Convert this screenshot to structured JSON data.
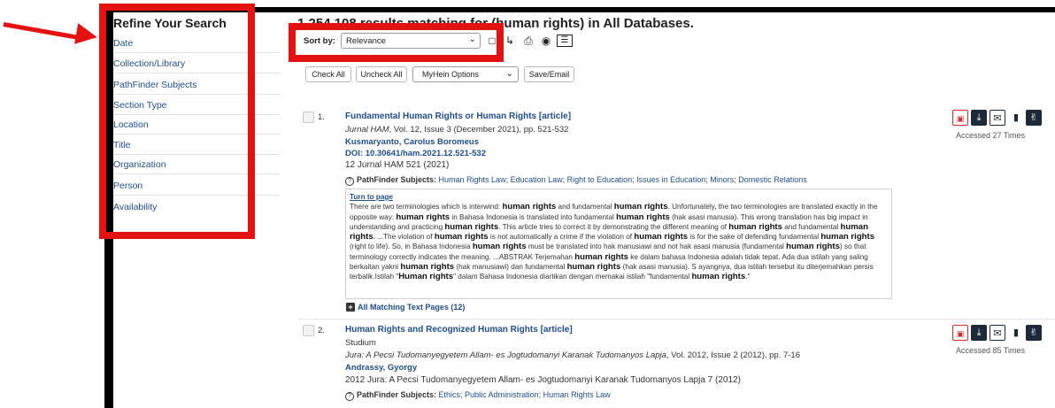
{
  "sidebar": {
    "title": "Refine Your Search",
    "facets": [
      "Date",
      "Collection/Library",
      "PathFinder Subjects",
      "Section Type",
      "Location",
      "Title",
      "Organization",
      "Person",
      "Availability"
    ]
  },
  "header": {
    "title": "1,254,108 results matching for (human rights) in All Databases."
  },
  "toolbar": {
    "sort_label": "Sort by:",
    "sort_value": "Relevance",
    "icons": [
      "refresh-icon",
      "sort-direction-icon",
      "print-icon",
      "binoculars-icon",
      "table-view-icon"
    ]
  },
  "actions": {
    "check_all": "Check All",
    "uncheck_all": "Uncheck All",
    "myhein": "MyHein Options",
    "save_email": "Save/Email"
  },
  "results": [
    {
      "num": "1.",
      "title": "Fundamental Human Rights or Human Rights [article]",
      "journal": "Jurnal HAM",
      "journal_detail": ", Vol. 12, Issue 3 (December 2021), pp. 521-532",
      "author": "Kusmaryanto, Carolus Boromeus",
      "doi": "DOI: 10.30641/ham.2021.12.521-532",
      "cite": "12 Jurnal HAM 521 (2021)",
      "pathfinder_label": "PathFinder Subjects:",
      "pathfinder": "Human Rights Law; Education Law; Right to Education; Issues in Education; Minors; Domestic Relations",
      "turn_to_page": "Turn to page",
      "snippet_parts": [
        {
          "t": "There are two terminologies which is interwind: "
        },
        {
          "h": "human rights"
        },
        {
          "t": " and fundamental "
        },
        {
          "h": "human rights"
        },
        {
          "t": ". Unfortunately, the two terminologies are translated exactly in the opposite way: "
        },
        {
          "h": "human rights"
        },
        {
          "t": " in Bahasa Indonesia is translated into fundamental "
        },
        {
          "h": "human rights"
        },
        {
          "t": " (hak asasi manusia). This wrong translation has big impact in understanding and practicing "
        },
        {
          "h": "human rights"
        },
        {
          "t": ". This article tries to correct it by demonstrating the different meaning of "
        },
        {
          "h": "human rights"
        },
        {
          "t": " and fundamental "
        },
        {
          "h": "human rights"
        },
        {
          "t": ". ...The violation of "
        },
        {
          "h": "human rights"
        },
        {
          "t": " is not automatically a crime if the violation of "
        },
        {
          "h": "human rights"
        },
        {
          "t": " is for the sake of defending fundamental "
        },
        {
          "h": "human rights"
        },
        {
          "t": " (right to life). So, in Bahasa Indonesia "
        },
        {
          "h": "human rights"
        },
        {
          "t": " must be translated into hak manusiawi and not hak asasi manusia (fundamental "
        },
        {
          "h": "human rights"
        },
        {
          "t": ") so that terminology correctly indicates the meaning. ...ABSTRAK Terjemahan "
        },
        {
          "h": "human rights"
        },
        {
          "t": " ke dalam bahasa Indonesia adalah tidak tepat. Ada dua istilah yang saling berkaitan yakni "
        },
        {
          "h": "human rights"
        },
        {
          "t": " (hak manusiawi) dan fundamental "
        },
        {
          "h": "human rights"
        },
        {
          "t": " (hak asasi manusia). S ayangnya, dua istilah tersebut itu diterjemahkan persis terbalik.Istilah \""
        },
        {
          "h": "Human rights"
        },
        {
          "t": "\" dalam Bahasa Indonesia diartikan dengan memakai istilah \"fundamental "
        },
        {
          "h": "human rights"
        },
        {
          "t": ".\""
        }
      ],
      "all_matching": "All Matching Text Pages (12)",
      "accessed": "Accessed 27 Times"
    },
    {
      "num": "2.",
      "title": "Human Rights and Recognized Human Rights [article]",
      "section": "Studium",
      "journal": "Jura: A Pecsi Tudomanyegyetem Allam- es Jogtudomanyi Karanak Tudomanyos Lapja",
      "journal_detail": ", Vol. 2012, Issue 2 (2012), pp. 7-16",
      "author": "Andrassy, Gyorgy",
      "cite": "2012 Jura: A Pecsi Tudomanyegyetem Allam- es Jogtudomanyi Karanak Tudomanyos Lapja 7 (2012)",
      "pathfinder_label": "PathFinder Subjects:",
      "pathfinder": "Ethics; Public Administration; Human Rights Law",
      "accessed": "Accessed 85 Times"
    }
  ],
  "result_action_icons": [
    "pdf-icon",
    "download-icon",
    "email-icon",
    "bookmark-icon",
    "thumbs-up-icon"
  ],
  "colors": {
    "annotation": "#e41111",
    "link": "#1f4e8c",
    "icon_dark": "#1d2a3a"
  }
}
